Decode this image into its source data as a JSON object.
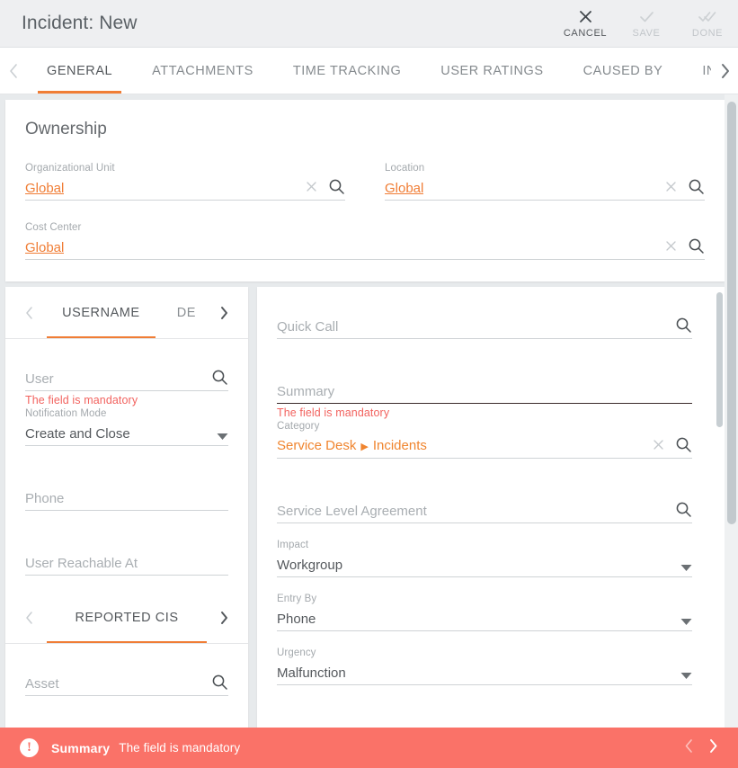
{
  "header": {
    "title": "Incident: New",
    "actions": [
      {
        "label": "CANCEL",
        "icon": "close-icon",
        "enabled": true
      },
      {
        "label": "SAVE",
        "icon": "check-icon",
        "enabled": false
      },
      {
        "label": "DONE",
        "icon": "double-check-icon",
        "enabled": false
      }
    ]
  },
  "tabs": [
    {
      "label": "GENERAL",
      "active": true
    },
    {
      "label": "ATTACHMENTS",
      "active": false
    },
    {
      "label": "TIME TRACKING",
      "active": false
    },
    {
      "label": "USER RATINGS",
      "active": false
    },
    {
      "label": "CAUSED BY",
      "active": false
    },
    {
      "label": "INCIDENT",
      "active": false
    }
  ],
  "ownership": {
    "title": "Ownership",
    "fields": {
      "org_unit": {
        "label": "Organizational Unit",
        "value": "Global"
      },
      "location": {
        "label": "Location",
        "value": "Global"
      },
      "cost_center": {
        "label": "Cost Center",
        "value": "Global"
      }
    }
  },
  "left_panel": {
    "tabs": [
      {
        "label": "USERNAME",
        "active": true
      },
      {
        "label": "DE",
        "active": false
      }
    ],
    "user": {
      "placeholder": "User",
      "error": "The field is mandatory"
    },
    "notification_mode": {
      "label": "Notification Mode",
      "value": "Create and Close"
    },
    "phone": {
      "placeholder": "Phone"
    },
    "user_reachable_at": {
      "placeholder": "User Reachable At"
    },
    "reported_cis": {
      "tabs": [
        {
          "label": "REPORTED CIS",
          "active": true
        }
      ],
      "asset": {
        "placeholder": "Asset"
      }
    }
  },
  "right_panel": {
    "quick_call": {
      "placeholder": "Quick Call"
    },
    "summary": {
      "placeholder": "Summary",
      "error": "The field is mandatory"
    },
    "category": {
      "label": "Category",
      "parent": "Service Desk",
      "child": "Incidents",
      "separator": "▶"
    },
    "sla": {
      "placeholder": "Service Level Agreement"
    },
    "impact": {
      "label": "Impact",
      "value": "Workgroup"
    },
    "entry_by": {
      "label": "Entry By",
      "value": "Phone"
    },
    "urgency": {
      "label": "Urgency",
      "value": "Malfunction"
    }
  },
  "error_bar": {
    "field": "Summary",
    "message": "The field is mandatory",
    "badge": "!",
    "prev": "prev-error",
    "next": "next-error"
  },
  "colors": {
    "accent": "#f07d35",
    "error": "#f2635f",
    "error_bar": "#fa7268",
    "background": "#e7eaec",
    "panel": "#ffffff"
  }
}
